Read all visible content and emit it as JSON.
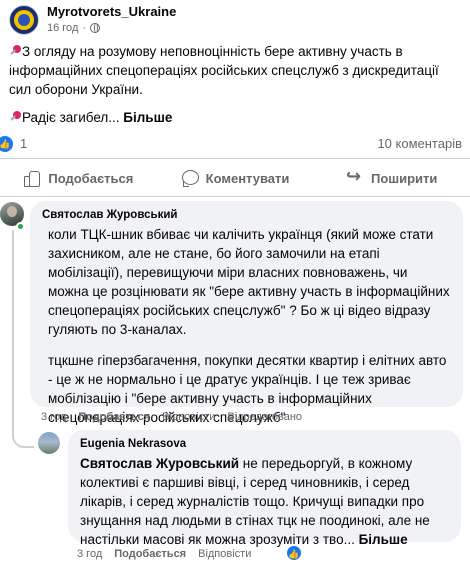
{
  "post": {
    "page_name": "Myrotvorets_Ukraine",
    "time": "16 год",
    "paragraph1": "З огляду на розумову неповноцінність бере активну участь в інформаційних спецопераціях російських спецслужб з дискредитації сил оборони України.",
    "paragraph2_text": "Радіє загибел... ",
    "more_label": "Більше",
    "like_count": "1",
    "comment_count": "10 коментарів"
  },
  "actions": {
    "like": "Подобається",
    "comment": "Коментувати",
    "share": "Поширити"
  },
  "comments": [
    {
      "author": "Святослав Журовський",
      "p1": "коли ТЦК-шник вбиває чи калічить українця (який може стати захисником, але не стане, бо його замочили на етапі мобілізації), перевищуючи міри власних повноважень, чи можна це розцінювати як \"бере активну участь в інформаційних спецопераціях російських спецслужб\" ? Бо ж ці відео відразу гуляють по 3-каналах.",
      "p2": "тцкшне гіперзбагачення, покупки десятки квартир і елітних авто - це ж не нормально і це дратує українців. І це теж зриває мобілізацію і \"бере активну участь в інформаційних спецопераціях російських спецслужб\"",
      "time": "3 год",
      "like": "Подобається",
      "reply": "Відповісти",
      "edited": "Відредаговано"
    },
    {
      "author": "Eugenia Nekrasova",
      "mention": "Святослав Журовський",
      "text": " не передьоргуй, в кожному колективі є паршиві вівці, і серед чиновників, і серед лікарів, і серед журналістів тощо. Кричущі випадки про знущання над людьми в стінах тцк не поодинокі, але не настільки масові як можна зрозуміти з тво... ",
      "more": "Більше",
      "time": "3 год",
      "like": "Подобається",
      "reply": "Відповісти",
      "reaction_count": ""
    }
  ],
  "colors": {
    "accent": "#1877f2",
    "muted": "#65676b",
    "bubble": "#f0f2f5",
    "online": "#31a24c"
  },
  "icons": [
    "globe-icon",
    "pin-icon",
    "like-icon",
    "comment-icon",
    "share-icon"
  ]
}
